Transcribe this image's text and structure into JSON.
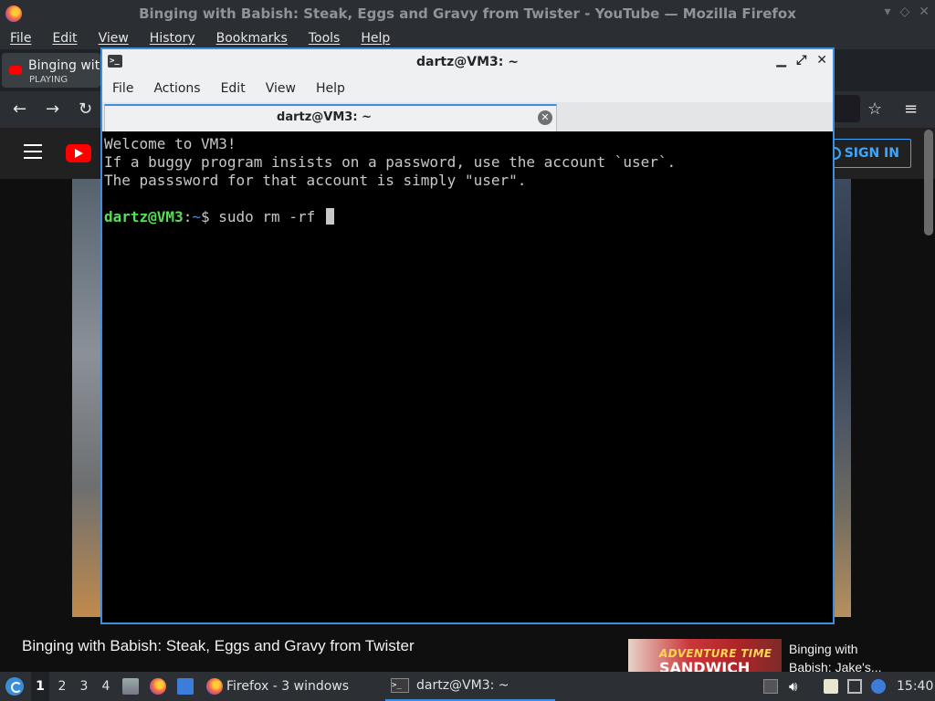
{
  "firefox": {
    "window_title": "Binging with Babish: Steak, Eggs and Gravy from Twister - YouTube — Mozilla Firefox",
    "menu": [
      "File",
      "Edit",
      "View",
      "History",
      "Bookmarks",
      "Tools",
      "Help"
    ],
    "tab": {
      "title": "Binging with",
      "status": "PLAYING"
    },
    "youtube": {
      "sign_in": "SIGN IN",
      "video_title": "Binging with Babish: Steak, Eggs and Gravy from Twister",
      "recommended": {
        "thumb_line1": "ADVENTURE TIME",
        "thumb_line2": "SANDWICH",
        "title_line1": "Binging with",
        "title_line2": "Babish: Jake's..."
      }
    }
  },
  "terminal": {
    "window_title": "dartz@VM3: ~",
    "menu": [
      "File",
      "Actions",
      "Edit",
      "View",
      "Help"
    ],
    "tab_label": "dartz@VM3: ~",
    "output_lines": [
      "Welcome to VM3!",
      "If a buggy program insists on a password, use the account `user`.",
      "The passsword for that account is simply \"user\"."
    ],
    "prompt": {
      "user_host": "dartz@VM3",
      "sep": ":",
      "path": "~",
      "symbol": "$",
      "command": " sudo rm -rf "
    }
  },
  "taskbar": {
    "workspaces": [
      "1",
      "2",
      "3",
      "4"
    ],
    "active_workspace": "1",
    "tasks": [
      {
        "label": "Firefox - 3 windows"
      },
      {
        "label": "dartz@VM3: ~"
      }
    ],
    "clock": "15:40"
  },
  "colors": {
    "accent": "#3d8ee0",
    "prompt_user": "#55e055",
    "youtube_red": "#ff0000",
    "signin_blue": "#3ea6ff"
  }
}
